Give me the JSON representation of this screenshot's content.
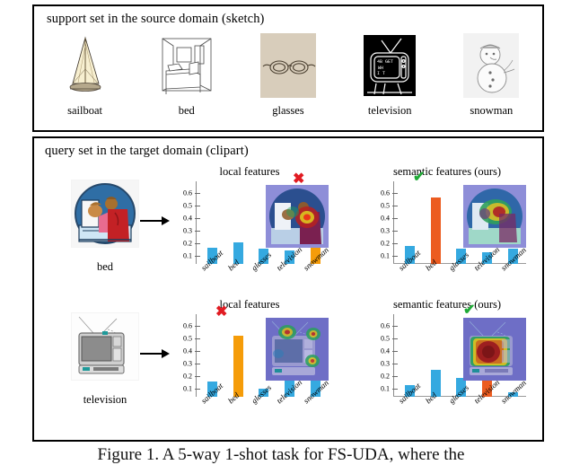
{
  "figure": {
    "caption": "Figure 1. A 5-way 1-shot task for FS-UDA, where the"
  },
  "support_panel": {
    "title": "support set in the source domain (sketch)",
    "items": [
      {
        "label": "sailboat",
        "icon": "sailboat-sketch"
      },
      {
        "label": "bed",
        "icon": "bed-sketch"
      },
      {
        "label": "glasses",
        "icon": "glasses-sketch"
      },
      {
        "label": "television",
        "icon": "television-sketch"
      },
      {
        "label": "snowman",
        "icon": "snowman-sketch"
      }
    ]
  },
  "query_panel": {
    "title": "query set in the target domain (clipart)",
    "rows": [
      {
        "query_label": "bed",
        "query_icon": "bed-clipart",
        "charts": [
          {
            "title": "local features",
            "mark": "✖",
            "mark_type": "cross",
            "heatmap": "bed-local-heatmap"
          },
          {
            "title": "semantic features (ours)",
            "mark": "✔",
            "mark_type": "check",
            "heatmap": "bed-semantic-heatmap"
          }
        ]
      },
      {
        "query_label": "television",
        "query_icon": "television-clipart",
        "charts": [
          {
            "title": "local features",
            "mark": "✖",
            "mark_type": "cross",
            "heatmap": "tv-local-heatmap"
          },
          {
            "title": "semantic features (ours)",
            "mark": "✔",
            "mark_type": "check",
            "heatmap": "tv-semantic-heatmap"
          }
        ]
      }
    ]
  },
  "colors": {
    "bar_blue": "#35a9e0",
    "bar_orange": "#f59c09",
    "bar_red_orange": "#ec5c20",
    "cross": "#e11b22",
    "check": "#1faa36",
    "panel_border": "#000000"
  },
  "chart_data": [
    {
      "id": "bed-local",
      "type": "bar",
      "title": "local features",
      "xlabel": "",
      "ylabel": "",
      "categories": [
        "sailboat",
        "bed",
        "glasses",
        "television",
        "snowman"
      ],
      "values": [
        0.13,
        0.17,
        0.12,
        0.11,
        0.45
      ],
      "colors": [
        "#35a9e0",
        "#35a9e0",
        "#35a9e0",
        "#35a9e0",
        "#f59c09"
      ],
      "yticks": [
        0.1,
        0.2,
        0.3,
        0.4,
        0.5,
        0.6
      ],
      "ytick_labels": [
        "0.1",
        "0.2",
        "0.3",
        "0.4",
        "0.5",
        "0.6"
      ],
      "ylim": [
        0,
        0.65
      ],
      "grid": false,
      "legend": "none",
      "annotation": {
        "symbol": "✖",
        "on_category": "snowman",
        "color": "#e11b22"
      },
      "prediction": "snowman",
      "correct": false
    },
    {
      "id": "bed-semantic",
      "type": "bar",
      "title": "semantic features (ours)",
      "xlabel": "",
      "ylabel": "",
      "categories": [
        "sailboat",
        "bed",
        "glasses",
        "television",
        "snowman"
      ],
      "values": [
        0.14,
        0.52,
        0.12,
        0.09,
        0.12
      ],
      "colors": [
        "#35a9e0",
        "#ec5c20",
        "#35a9e0",
        "#35a9e0",
        "#35a9e0"
      ],
      "yticks": [
        0.1,
        0.2,
        0.3,
        0.4,
        0.5,
        0.6
      ],
      "ytick_labels": [
        "0.1",
        "0.2",
        "0.3",
        "0.4",
        "0.5",
        "0.6"
      ],
      "ylim": [
        0,
        0.65
      ],
      "grid": false,
      "legend": "none",
      "annotation": {
        "symbol": "✔",
        "on_category": "bed",
        "color": "#1faa36"
      },
      "prediction": "bed",
      "correct": true
    },
    {
      "id": "tv-local",
      "type": "bar",
      "title": "local features",
      "xlabel": "",
      "ylabel": "",
      "categories": [
        "sailboat",
        "bed",
        "glasses",
        "television",
        "snowman"
      ],
      "values": [
        0.12,
        0.48,
        0.06,
        0.17,
        0.13
      ],
      "colors": [
        "#35a9e0",
        "#f59c09",
        "#35a9e0",
        "#35a9e0",
        "#35a9e0"
      ],
      "yticks": [
        0.1,
        0.2,
        0.3,
        0.4,
        0.5,
        0.6
      ],
      "ytick_labels": [
        "0.1",
        "0.2",
        "0.3",
        "0.4",
        "0.5",
        "0.6"
      ],
      "ylim": [
        0,
        0.65
      ],
      "grid": false,
      "legend": "none",
      "annotation": {
        "symbol": "✖",
        "on_category": "bed",
        "color": "#e11b22"
      },
      "prediction": "bed",
      "correct": false
    },
    {
      "id": "tv-semantic",
      "type": "bar",
      "title": "semantic features (ours)",
      "xlabel": "",
      "ylabel": "",
      "categories": [
        "sailboat",
        "bed",
        "glasses",
        "television",
        "snowman"
      ],
      "values": [
        0.09,
        0.21,
        0.15,
        0.53,
        0.03
      ],
      "colors": [
        "#35a9e0",
        "#35a9e0",
        "#35a9e0",
        "#ec5c20",
        "#35a9e0"
      ],
      "yticks": [
        0.1,
        0.2,
        0.3,
        0.4,
        0.5,
        0.6
      ],
      "ytick_labels": [
        "0.1",
        "0.2",
        "0.3",
        "0.4",
        "0.5",
        "0.6"
      ],
      "ylim": [
        0,
        0.65
      ],
      "grid": false,
      "legend": "none",
      "annotation": {
        "symbol": "✔",
        "on_category": "television",
        "color": "#1faa36"
      },
      "prediction": "television",
      "correct": true
    }
  ]
}
